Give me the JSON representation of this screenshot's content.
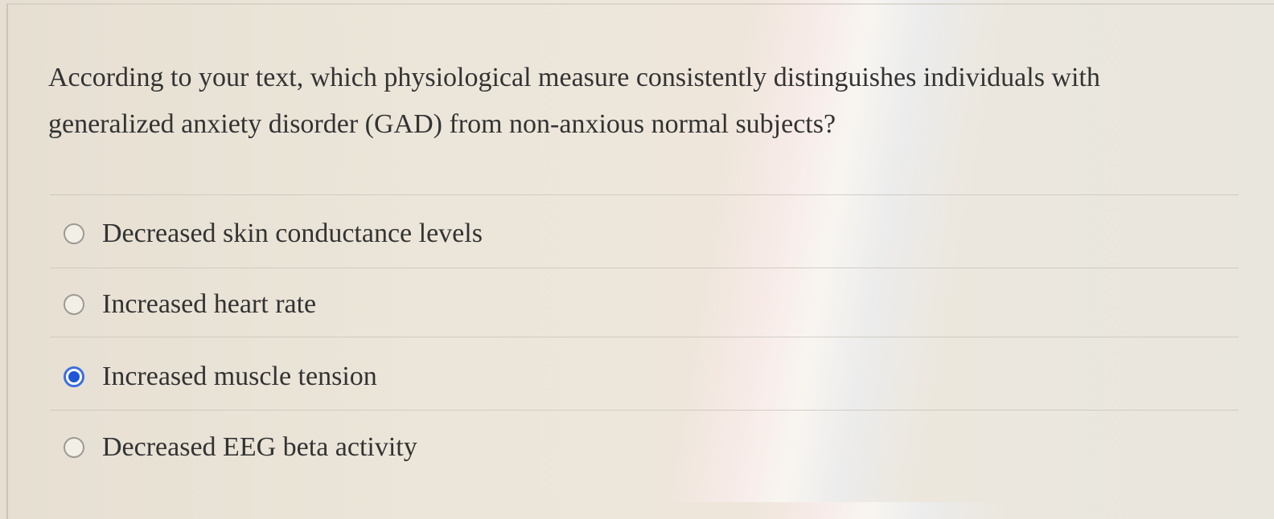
{
  "question": {
    "text": "According to your text, which physiological measure consistently distinguishes individuals with generalized anxiety disorder (GAD) from non-anxious normal subjects?"
  },
  "choices": [
    {
      "label": "Decreased skin conductance levels",
      "selected": false,
      "icon": "radio-unchecked-icon"
    },
    {
      "label": "Increased heart rate",
      "selected": false,
      "icon": "radio-unchecked-icon"
    },
    {
      "label": "Increased muscle tension",
      "selected": true,
      "icon": "radio-checked-icon"
    },
    {
      "label": "Decreased EEG beta activity",
      "selected": false,
      "icon": "radio-unchecked-icon"
    }
  ],
  "colors": {
    "accent": "#1f56d8",
    "text": "#333333"
  }
}
